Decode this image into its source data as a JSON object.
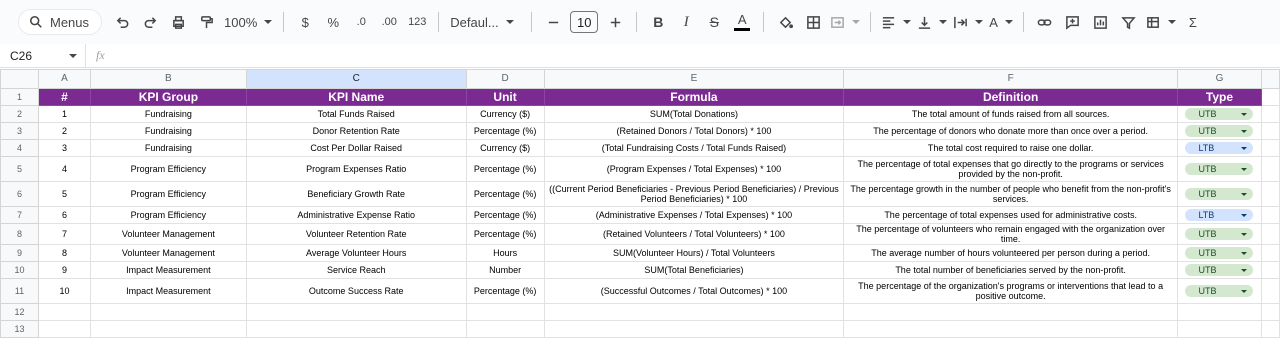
{
  "toolbar": {
    "menus_label": "Menus",
    "zoom": "100%",
    "currency": "$",
    "percent": "%",
    "dec_decrease": ".0",
    "dec_increase": ".00",
    "number_format": "123",
    "font": "Defaul...",
    "font_size": "10",
    "bold": "B",
    "italic": "I",
    "strike": "S",
    "text_color": "A",
    "text_rotate": "A",
    "functions": "Σ"
  },
  "formula_bar": {
    "cell_ref": "C26",
    "fx": "fx"
  },
  "columns": [
    "A",
    "B",
    "C",
    "D",
    "E",
    "F",
    "G"
  ],
  "row_numbers": [
    "1",
    "2",
    "3",
    "4",
    "5",
    "6",
    "7",
    "8",
    "9",
    "10",
    "11",
    "12",
    "13"
  ],
  "colors": {
    "header_bg": "#7b2a91",
    "utb_bg": "#d4e8d0",
    "ltb_bg": "#d3e3fd"
  },
  "table": {
    "headers": [
      "#",
      "KPI Group",
      "KPI Name",
      "Unit",
      "Formula",
      "Definition",
      "Type"
    ],
    "rows": [
      [
        "1",
        "Fundraising",
        "Total Funds Raised",
        "Currency ($)",
        "SUM(Total Donations)",
        "The total amount of funds raised from all sources.",
        "UTB"
      ],
      [
        "2",
        "Fundraising",
        "Donor Retention Rate",
        "Percentage (%)",
        "(Retained Donors / Total Donors) * 100",
        "The percentage of donors who donate more than once over a period.",
        "UTB"
      ],
      [
        "3",
        "Fundraising",
        "Cost Per Dollar Raised",
        "Currency ($)",
        "(Total Fundraising Costs / Total Funds Raised)",
        "The total cost required to raise one dollar.",
        "LTB"
      ],
      [
        "4",
        "Program Efficiency",
        "Program Expenses Ratio",
        "Percentage (%)",
        "(Program Expenses / Total Expenses) * 100",
        "The percentage of total expenses that go directly to the programs or services provided by the non-profit.",
        "UTB"
      ],
      [
        "5",
        "Program Efficiency",
        "Beneficiary Growth Rate",
        "Percentage (%)",
        "((Current Period Beneficiaries - Previous Period Beneficiaries) / Previous Period Beneficiaries) * 100",
        "The percentage growth in the number of people who benefit from the non-profit's services.",
        "UTB"
      ],
      [
        "6",
        "Program Efficiency",
        "Administrative Expense Ratio",
        "Percentage (%)",
        "(Administrative Expenses / Total Expenses) * 100",
        "The percentage of total expenses used for administrative costs.",
        "LTB"
      ],
      [
        "7",
        "Volunteer Management",
        "Volunteer Retention Rate",
        "Percentage (%)",
        "(Retained Volunteers / Total Volunteers) * 100",
        "The percentage of volunteers who remain engaged with the organization over time.",
        "UTB"
      ],
      [
        "8",
        "Volunteer Management",
        "Average Volunteer Hours",
        "Hours",
        "SUM(Volunteer Hours) / Total Volunteers",
        "The average number of hours volunteered per person during a period.",
        "UTB"
      ],
      [
        "9",
        "Impact Measurement",
        "Service Reach",
        "Number",
        "SUM(Total Beneficiaries)",
        "The total number of beneficiaries served by the non-profit.",
        "UTB"
      ],
      [
        "10",
        "Impact Measurement",
        "Outcome Success Rate",
        "Percentage (%)",
        "(Successful Outcomes / Total Outcomes) * 100",
        "The percentage of the organization's programs or interventions that lead to a positive outcome.",
        "UTB"
      ]
    ]
  }
}
